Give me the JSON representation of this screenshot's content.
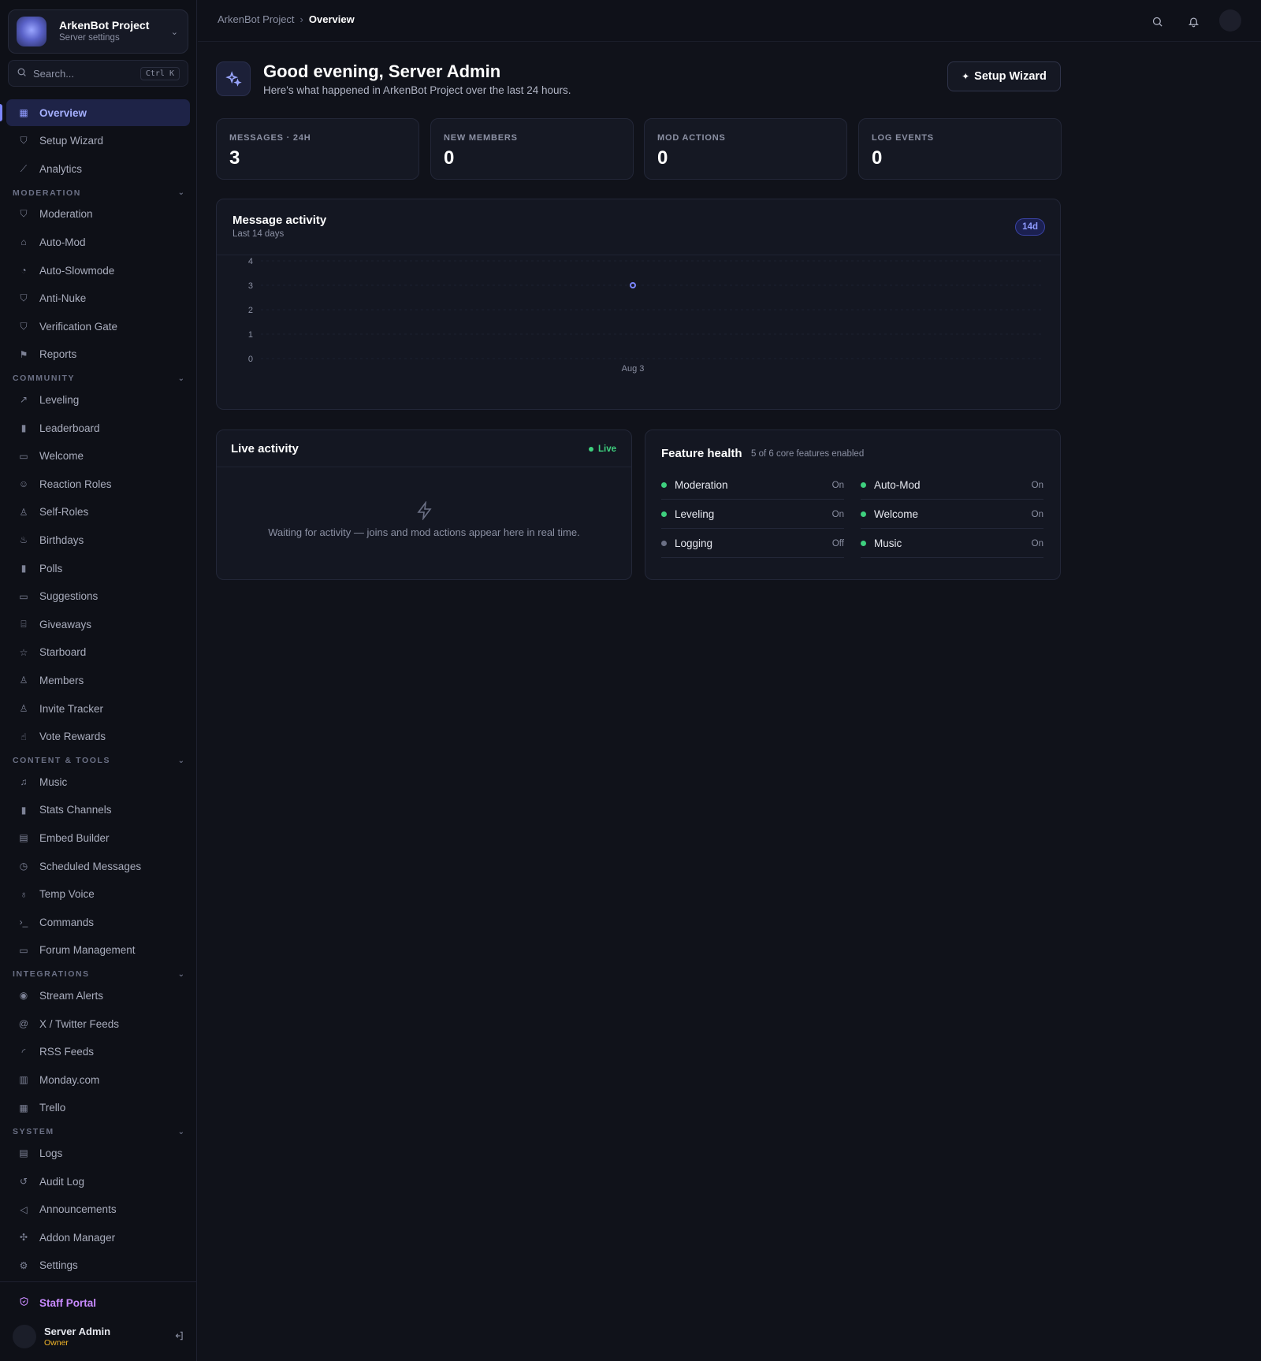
{
  "server": {
    "name": "ArkenBot Project",
    "subtitle": "Server settings"
  },
  "search": {
    "placeholder": "Search...",
    "shortcut": "Ctrl K"
  },
  "nav": {
    "top": [
      {
        "label": "Overview",
        "icon": "grid-icon",
        "active": true
      },
      {
        "label": "Setup Wizard",
        "icon": "shield-icon"
      },
      {
        "label": "Analytics",
        "icon": "chart-line-icon"
      }
    ],
    "sections": [
      {
        "title": "MODERATION",
        "items": [
          {
            "label": "Moderation",
            "icon": "shield-icon"
          },
          {
            "label": "Auto-Mod",
            "icon": "bot-icon"
          },
          {
            "label": "Auto-Slowmode",
            "icon": "timer-icon"
          },
          {
            "label": "Anti-Nuke",
            "icon": "shield-icon"
          },
          {
            "label": "Verification Gate",
            "icon": "shield-check-icon"
          },
          {
            "label": "Reports",
            "icon": "flag-icon"
          }
        ]
      },
      {
        "title": "COMMUNITY",
        "items": [
          {
            "label": "Leveling",
            "icon": "trending-up-icon"
          },
          {
            "label": "Leaderboard",
            "icon": "bar-chart-icon"
          },
          {
            "label": "Welcome",
            "icon": "message-icon"
          },
          {
            "label": "Reaction Roles",
            "icon": "smile-icon"
          },
          {
            "label": "Self-Roles",
            "icon": "user-icon"
          },
          {
            "label": "Birthdays",
            "icon": "cake-icon"
          },
          {
            "label": "Polls",
            "icon": "bar-chart-icon"
          },
          {
            "label": "Suggestions",
            "icon": "message-plus-icon"
          },
          {
            "label": "Giveaways",
            "icon": "gift-icon"
          },
          {
            "label": "Starboard",
            "icon": "star-icon"
          },
          {
            "label": "Members",
            "icon": "users-icon"
          },
          {
            "label": "Invite Tracker",
            "icon": "user-plus-icon"
          },
          {
            "label": "Vote Rewards",
            "icon": "thumbs-up-icon"
          }
        ]
      },
      {
        "title": "CONTENT & TOOLS",
        "items": [
          {
            "label": "Music",
            "icon": "music-icon"
          },
          {
            "label": "Stats Channels",
            "icon": "bar-chart-icon"
          },
          {
            "label": "Embed Builder",
            "icon": "layout-icon"
          },
          {
            "label": "Scheduled Messages",
            "icon": "clock-icon"
          },
          {
            "label": "Temp Voice",
            "icon": "mic-icon"
          },
          {
            "label": "Commands",
            "icon": "terminal-icon"
          },
          {
            "label": "Forum Management",
            "icon": "messages-icon"
          }
        ]
      },
      {
        "title": "INTEGRATIONS",
        "items": [
          {
            "label": "Stream Alerts",
            "icon": "radio-icon"
          },
          {
            "label": "X / Twitter Feeds",
            "icon": "at-icon"
          },
          {
            "label": "RSS Feeds",
            "icon": "rss-icon"
          },
          {
            "label": "Monday.com",
            "icon": "clipboard-icon"
          },
          {
            "label": "Trello",
            "icon": "trello-icon"
          }
        ]
      },
      {
        "title": "SYSTEM",
        "items": [
          {
            "label": "Logs",
            "icon": "file-icon"
          },
          {
            "label": "Audit Log",
            "icon": "history-icon"
          },
          {
            "label": "Announcements",
            "icon": "megaphone-icon"
          },
          {
            "label": "Addon Manager",
            "icon": "puzzle-icon"
          },
          {
            "label": "Settings",
            "icon": "gear-icon"
          }
        ]
      }
    ]
  },
  "staff_portal": {
    "label": "Staff Portal"
  },
  "user": {
    "name": "Server Admin",
    "role": "Owner"
  },
  "breadcrumb": {
    "parent": "ArkenBot Project",
    "current": "Overview"
  },
  "header": {
    "greeting": "Good evening, Server Admin",
    "subtitle": "Here's what happened in ArkenBot Project over the last 24 hours.",
    "wizard_button": "Setup Wizard"
  },
  "stats": [
    {
      "label": "MESSAGES · 24H",
      "value": "3"
    },
    {
      "label": "NEW MEMBERS",
      "value": "0"
    },
    {
      "label": "MOD ACTIONS",
      "value": "0"
    },
    {
      "label": "LOG EVENTS",
      "value": "0"
    }
  ],
  "activity_chart": {
    "title": "Message activity",
    "subtitle": "Last 14 days",
    "range": "14d"
  },
  "chart_data": {
    "type": "scatter",
    "title": "Message activity",
    "subtitle": "Last 14 days",
    "x": [
      "Aug 3"
    ],
    "y": [
      3
    ],
    "y_ticks": [
      0,
      1,
      2,
      3,
      4
    ],
    "ylim": [
      0,
      4
    ],
    "grid": true,
    "color": "#7c86ff"
  },
  "live_activity": {
    "title": "Live activity",
    "badge": "Live",
    "empty_text": "Waiting for activity — joins and mod actions appear here in real time."
  },
  "feature_health": {
    "title": "Feature health",
    "summary": "5 of 6 core features enabled",
    "features": [
      {
        "name": "Moderation",
        "state": "On",
        "enabled": true
      },
      {
        "name": "Auto-Mod",
        "state": "On",
        "enabled": true
      },
      {
        "name": "Leveling",
        "state": "On",
        "enabled": true
      },
      {
        "name": "Welcome",
        "state": "On",
        "enabled": true
      },
      {
        "name": "Logging",
        "state": "Off",
        "enabled": false
      },
      {
        "name": "Music",
        "state": "On",
        "enabled": true
      }
    ]
  },
  "colors": {
    "accent": "#7c86ff",
    "on": "#3ed07e",
    "off": "#6b7085",
    "staff": "#c98bff",
    "owner": "#f0b429"
  }
}
